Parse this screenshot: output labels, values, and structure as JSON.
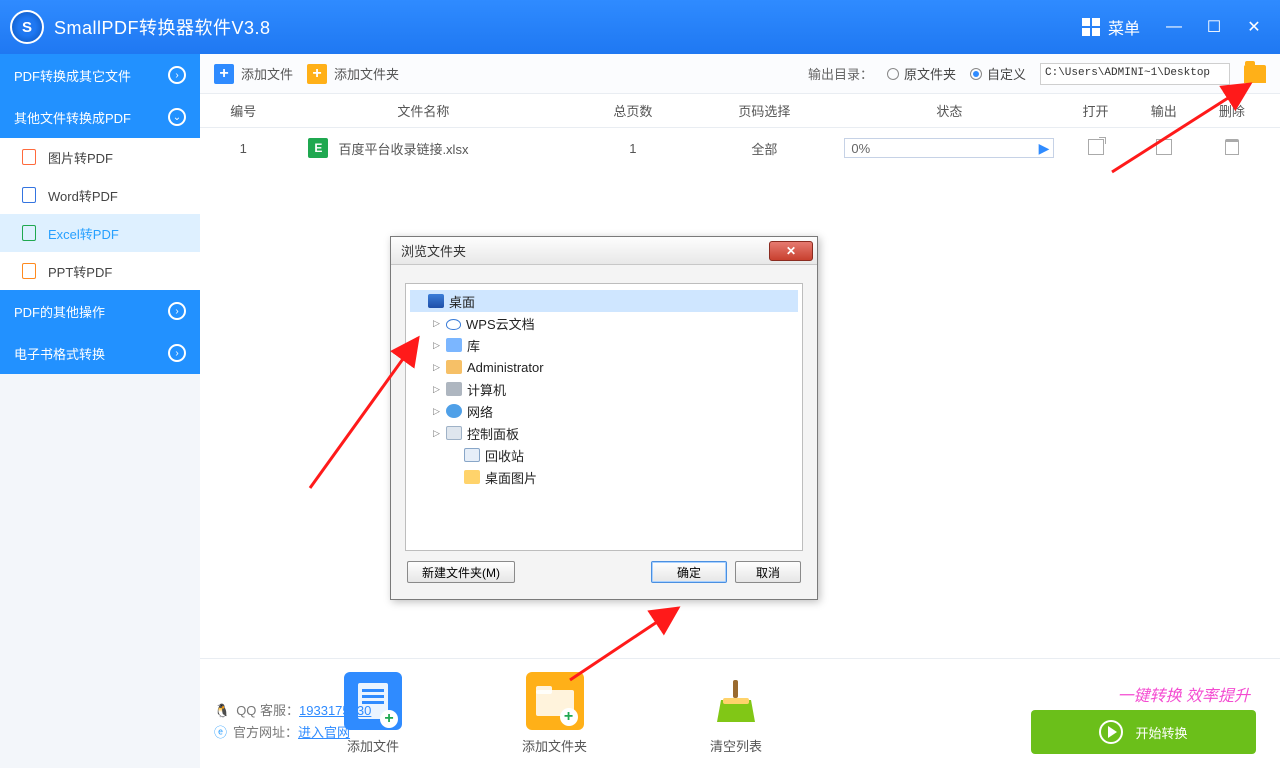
{
  "titlebar": {
    "title": "SmallPDF转换器软件V3.8",
    "menu": "菜单"
  },
  "sidebar": {
    "cats": [
      {
        "label": "PDF转换成其它文件"
      },
      {
        "label": "其他文件转换成PDF"
      },
      {
        "label": "PDF的其他操作"
      },
      {
        "label": "电子书格式转换"
      }
    ],
    "subs": [
      {
        "label": "图片转PDF"
      },
      {
        "label": "Word转PDF"
      },
      {
        "label": "Excel转PDF"
      },
      {
        "label": "PPT转PDF"
      }
    ]
  },
  "toolbar": {
    "addFile": "添加文件",
    "addFolder": "添加文件夹",
    "outLabel": "输出目录：",
    "radioSrc": "原文件夹",
    "radioCustom": "自定义",
    "path": "C:\\Users\\ADMINI~1\\Desktop"
  },
  "table": {
    "head": {
      "num": "编号",
      "name": "文件名称",
      "pages": "总页数",
      "sel": "页码选择",
      "status": "状态",
      "open": "打开",
      "out": "输出",
      "del": "删除"
    },
    "rows": [
      {
        "num": "1",
        "icon": "E",
        "name": "百度平台收录链接.xlsx",
        "pages": "1",
        "sel": "全部",
        "pct": "0%"
      }
    ]
  },
  "dialog": {
    "title": "浏览文件夹",
    "tree": [
      {
        "label": "桌面",
        "icon": "desktop",
        "sel": true,
        "depth": 0,
        "exp": ""
      },
      {
        "label": "WPS云文档",
        "icon": "cloud",
        "depth": 1,
        "exp": "▷"
      },
      {
        "label": "库",
        "icon": "lib",
        "depth": 1,
        "exp": "▷"
      },
      {
        "label": "Administrator",
        "icon": "user",
        "depth": 1,
        "exp": "▷"
      },
      {
        "label": "计算机",
        "icon": "pc",
        "depth": 1,
        "exp": "▷"
      },
      {
        "label": "网络",
        "icon": "net",
        "depth": 1,
        "exp": "▷"
      },
      {
        "label": "控制面板",
        "icon": "ctrl",
        "depth": 1,
        "exp": "▷"
      },
      {
        "label": "回收站",
        "icon": "bin",
        "depth": 2,
        "exp": ""
      },
      {
        "label": "桌面图片",
        "icon": "fld",
        "depth": 2,
        "exp": ""
      }
    ],
    "newFolder": "新建文件夹(M)",
    "ok": "确定",
    "cancel": "取消"
  },
  "bottom": {
    "qqLabel": "QQ 客服：",
    "qq": "1933175230",
    "siteLabel": "官方网址：",
    "site": "进入官网",
    "addFile": "添加文件",
    "addFolder": "添加文件夹",
    "clear": "清空列表",
    "oneclick": "一键转换  效率提升",
    "start": "开始转换"
  }
}
